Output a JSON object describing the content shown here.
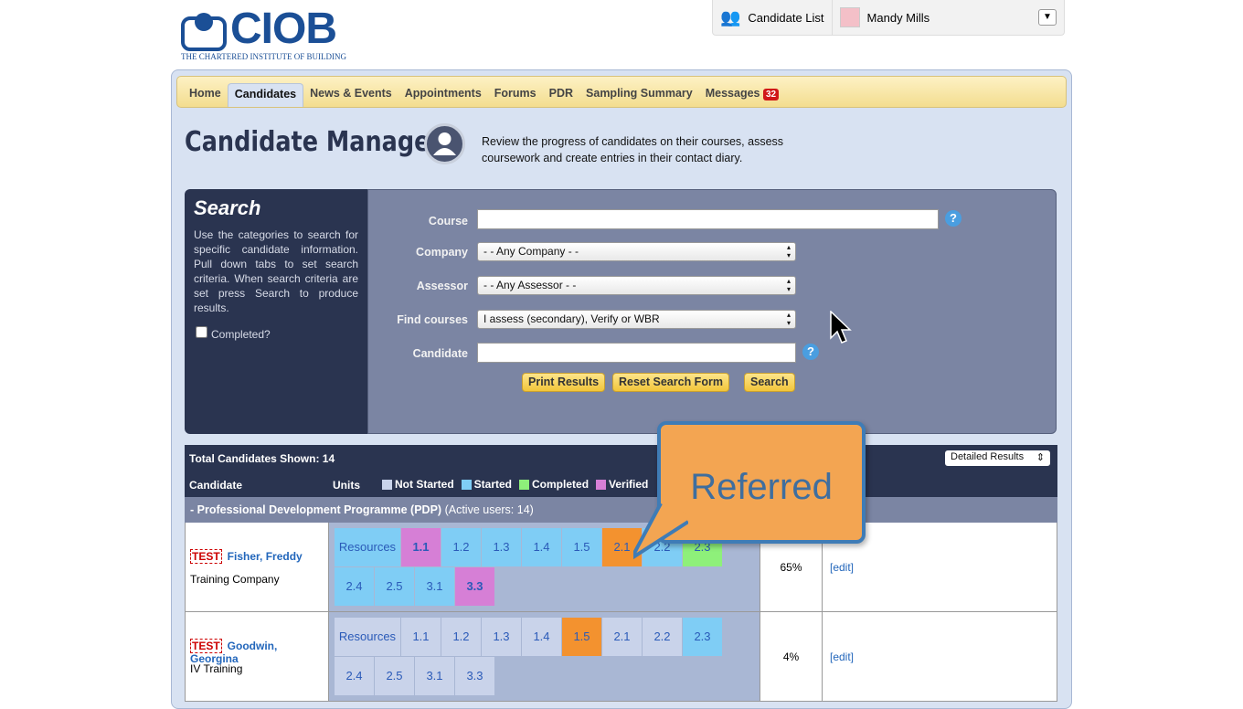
{
  "logo": {
    "word": "CIOB",
    "sub": "THE CHARTERED INSTITUTE OF BUILDING"
  },
  "userbar": {
    "candidate_list": "Candidate List",
    "user": "Mandy Mills"
  },
  "nav": [
    {
      "label": "Home"
    },
    {
      "label": "Candidates",
      "active": true
    },
    {
      "label": "News & Events"
    },
    {
      "label": "Appointments"
    },
    {
      "label": "Forums"
    },
    {
      "label": "PDR"
    },
    {
      "label": "Sampling Summary"
    },
    {
      "label": "Messages",
      "badge": "32"
    }
  ],
  "page": {
    "title": "Candidate Manager",
    "description": "Review the progress of candidates on their courses, assess coursework and create entries in their contact diary."
  },
  "search": {
    "title": "Search",
    "help": "Use the categories to search for specific candidate information. Pull down tabs to set search criteria. When search criteria are set press Search to produce results.",
    "completed_label": "Completed?",
    "course_label": "Course",
    "course_value": "",
    "company_label": "Company",
    "company_value": "- - Any Company - -",
    "assessor_label": "Assessor",
    "assessor_value": "- - Any Assessor - -",
    "find_label": "Find courses",
    "find_value": "I assess (secondary), Verify or WBR",
    "candidate_label": "Candidate",
    "candidate_value": "",
    "print": "Print Results",
    "reset": "Reset Search Form",
    "search": "Search"
  },
  "results": {
    "total": "Total Candidates Shown: 14",
    "view": "Detailed Results",
    "col_candidate": "Candidate",
    "col_units": "Units",
    "legend": [
      {
        "label": "Not Started",
        "color": "#c9d3ea"
      },
      {
        "label": "Started",
        "color": "#7fcdf5"
      },
      {
        "label": "Completed",
        "color": "#8ef07a"
      },
      {
        "label": "Verified",
        "color": "#d67fd6"
      }
    ],
    "group": "- Professional Development Programme (PDP)",
    "group_users": "(Active users: 14)",
    "rows": [
      {
        "tag": "TEST",
        "name": "Fisher, Freddy",
        "company": "Training Company",
        "percent": "65%",
        "edit": "[edit]",
        "units": [
          [
            "Resources",
            "started"
          ],
          [
            "1.1",
            "verified"
          ],
          [
            "1.2",
            "started"
          ],
          [
            "1.3",
            "started"
          ],
          [
            "1.4",
            "started"
          ],
          [
            "1.5",
            "started"
          ],
          [
            "2.1",
            "referred"
          ],
          [
            "2.2",
            "started"
          ],
          [
            "2.3",
            "completed"
          ],
          [
            "2.4",
            "started"
          ],
          [
            "2.5",
            "started"
          ],
          [
            "3.1",
            "started"
          ],
          [
            "3.3",
            "verified"
          ]
        ]
      },
      {
        "tag": "TEST",
        "name": "Goodwin, Georgina",
        "company": "IV Training",
        "percent": "4%",
        "edit": "[edit]",
        "units": [
          [
            "Resources",
            "not"
          ],
          [
            "1.1",
            "not"
          ],
          [
            "1.2",
            "not"
          ],
          [
            "1.3",
            "not"
          ],
          [
            "1.4",
            "not"
          ],
          [
            "1.5",
            "referred"
          ],
          [
            "2.1",
            "not"
          ],
          [
            "2.2",
            "not"
          ],
          [
            "2.3",
            "started"
          ],
          [
            "2.4",
            "not"
          ],
          [
            "2.5",
            "not"
          ],
          [
            "3.1",
            "not"
          ],
          [
            "3.3",
            "not"
          ]
        ]
      }
    ]
  },
  "status_colors": {
    "not": "#c9d3ea",
    "started": "#7fcdf5",
    "completed": "#8ef07a",
    "verified": "#d67fd6",
    "referred": "#f3922f"
  },
  "callout": "Referred"
}
